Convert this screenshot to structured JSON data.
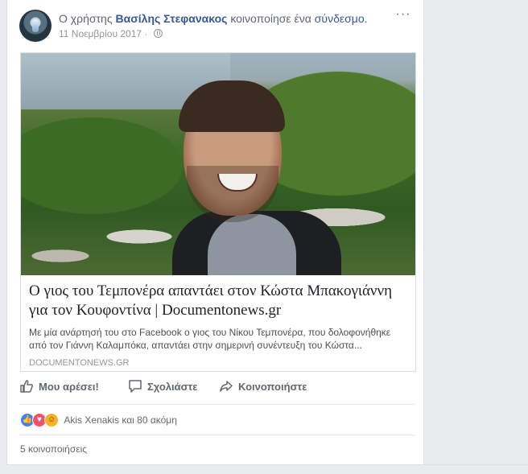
{
  "post": {
    "prefix": "Ο χρήστης",
    "author": "Βασίλης Στεφανακος",
    "action_prefix": "κοινοποίησε ένα",
    "action_link": "σύνδεσμο",
    "action_suffix": ".",
    "date": "11 Νοεμβρίου 2017 ·",
    "audience_icon": "globe-icon",
    "more_label": "···"
  },
  "link_preview": {
    "title": "Ο γιος του Τεμπονέρα απαντάει στον Κώστα Μπακογιάννη για τον Κουφοντίνα | Documentonews.gr",
    "description": "Με μία ανάρτησή του στο Facebook ο γιος του Νίκου Τεμπονέρα, που δολοφονήθηκε από τον Γιάννη Καλαμπόκα, απαντάει στην σημερινή συνέντευξη του Κώστα...",
    "domain": "DOCUMENTONEWS.GR"
  },
  "actions": {
    "like": "Μου αρέσει!",
    "comment": "Σχολιάστε",
    "share": "Κοινοποιήστε"
  },
  "reactions": {
    "icons": [
      "like-icon",
      "love-icon",
      "haha-icon"
    ],
    "text": "Akis Xenakis και 80 ακόμη"
  },
  "shares": "5 κοινοποιήσεις",
  "colors": {
    "link_blue": "#365899",
    "background": "#e9ebee",
    "like_blue": "#4080ff",
    "love_red": "#f25268",
    "haha_yellow": "#f7b125"
  }
}
